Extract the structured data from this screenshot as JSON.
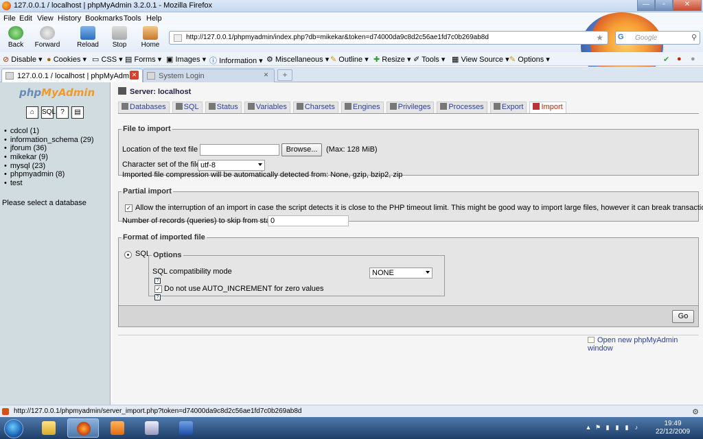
{
  "window": {
    "title": "127.0.0.1 / localhost | phpMyAdmin 3.2.0.1 - Mozilla Firefox",
    "controls": {
      "minimize": "—",
      "maximize": "▫",
      "close": "✕"
    }
  },
  "menu": [
    "File",
    "Edit",
    "View",
    "History",
    "Bookmarks",
    "Tools",
    "Help"
  ],
  "nav": {
    "back": "Back",
    "forward": "Forward",
    "reload": "Reload",
    "stop": "Stop",
    "home": "Home",
    "url": "http://127.0.0.1/phpmyadmin/index.php?db=mikekar&token=d74000da9c8d2c56ae1fd7c0b269ab8d",
    "search_engine": "G",
    "search_placeholder": "Google"
  },
  "webdev": [
    "Disable ▾",
    "Cookies ▾",
    "CSS ▾",
    "Forms ▾",
    "Images ▾",
    "Information ▾",
    "Miscellaneous ▾",
    "Outline ▾",
    "Resize ▾",
    "Tools ▾",
    "View Source ▾",
    "Options ▾"
  ],
  "browser_tabs": [
    {
      "label": "127.0.0.1 / localhost | phpMyAdm..."
    },
    {
      "label": "System Login"
    }
  ],
  "left": {
    "logo_a": "php",
    "logo_b": "MyAdmin",
    "icons": [
      "⌂",
      "SQL",
      "?",
      "▤"
    ],
    "databases": [
      "cdcol (1)",
      "information_schema (29)",
      "jforum (36)",
      "mikekar (9)",
      "mysql (23)",
      "phpmyadmin (8)",
      "test"
    ],
    "select_db": "Please select a database"
  },
  "main": {
    "server": "Server: localhost",
    "tabs": [
      "Databases",
      "SQL",
      "Status",
      "Variables",
      "Charsets",
      "Engines",
      "Privileges",
      "Processes",
      "Export",
      "Import"
    ],
    "active_tab": "Import",
    "file_import": {
      "legend": "File to import",
      "location_label": "Location of the text file",
      "browse": "Browse...",
      "max": "(Max: 128 MiB)",
      "charset_label": "Character set of the file:",
      "charset_value": "utf-8",
      "compression_note": "Imported file compression will be automatically detected from: None, gzip, bzip2, zip"
    },
    "partial_import": {
      "legend": "Partial import",
      "allow_interrupt": "Allow the interruption of an import in case the script detects it is close to the PHP timeout limit. This might be good way to import large files, however it can break transactions.",
      "skip_label": "Number of records (queries) to skip from start",
      "skip_value": "0"
    },
    "format": {
      "legend": "Format of imported file",
      "format_sql": "SQL",
      "options_legend": "Options",
      "compat_label": "SQL compatibility mode",
      "compat_value": "NONE",
      "no_auto_inc": "Do not use AUTO_INCREMENT for zero values"
    },
    "go": "Go",
    "new_window": "Open new phpMyAdmin window"
  },
  "status": {
    "url": "http://127.0.0.1/phpmyadmin/server_import.php?token=d74000da9c8d2c56ae1fd7c0b269ab8d"
  },
  "clock": {
    "time": "19:49",
    "date": "22/12/2009"
  }
}
